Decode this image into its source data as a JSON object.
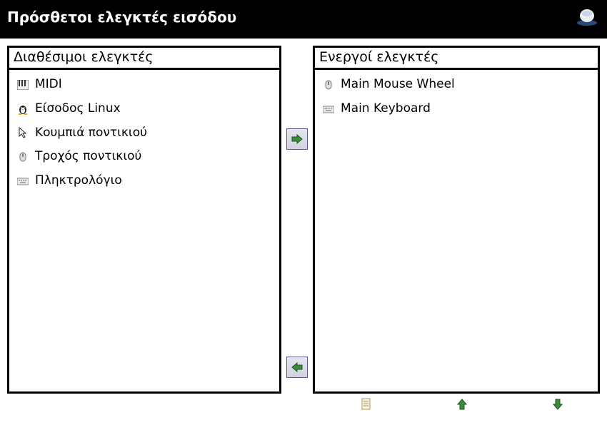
{
  "titlebar": {
    "title": "Πρόσθετοι ελεγκτές εισόδου"
  },
  "available": {
    "header": "Διαθέσιμοι ελεγκτές",
    "items": [
      {
        "icon": "midi-icon",
        "label": "MIDI"
      },
      {
        "icon": "penguin-icon",
        "label": "Είσοδος Linux"
      },
      {
        "icon": "cursor-icon",
        "label": "Κουμπιά ποντικιού"
      },
      {
        "icon": "wheel-icon",
        "label": "Τροχός ποντικιού"
      },
      {
        "icon": "keyboard-icon",
        "label": "Πληκτρολόγιο"
      }
    ]
  },
  "active": {
    "header": "Ενεργοί ελεγκτές",
    "items": [
      {
        "icon": "wheel-icon",
        "label": "Main Mouse Wheel"
      },
      {
        "icon": "keyboard-icon",
        "label": "Main Keyboard"
      }
    ]
  },
  "buttons": {
    "addLabel": "→",
    "removeLabel": "←",
    "configLabel": "config",
    "upLabel": "up",
    "downLabel": "down"
  }
}
